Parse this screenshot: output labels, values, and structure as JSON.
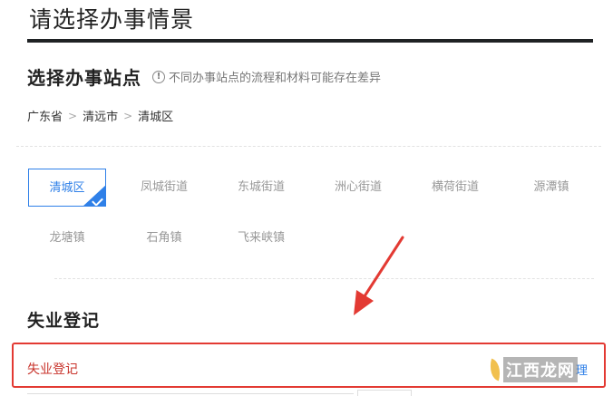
{
  "page": {
    "title": "请选择办事情景"
  },
  "section": {
    "title": "选择办事站点",
    "notice": "不同办事站点的流程和材料可能存在差异"
  },
  "breadcrumb": [
    "广东省",
    "清远市",
    "清城区"
  ],
  "stations": [
    {
      "label": "清城区",
      "selected": true
    },
    {
      "label": "凤城街道"
    },
    {
      "label": "东城街道"
    },
    {
      "label": "洲心街道"
    },
    {
      "label": "横荷街道"
    },
    {
      "label": "源潭镇"
    },
    {
      "label": "龙塘镇"
    },
    {
      "label": "石角镇"
    },
    {
      "label": "飞来峡镇"
    }
  ],
  "service": {
    "title": "失业登记",
    "item_label": "失业登记",
    "item_tail": "理"
  },
  "watermark": {
    "text": "江西龙网"
  },
  "colors": {
    "accent": "#2f80e8",
    "highlight": "#e33a33",
    "item_text": "#c8332b"
  }
}
